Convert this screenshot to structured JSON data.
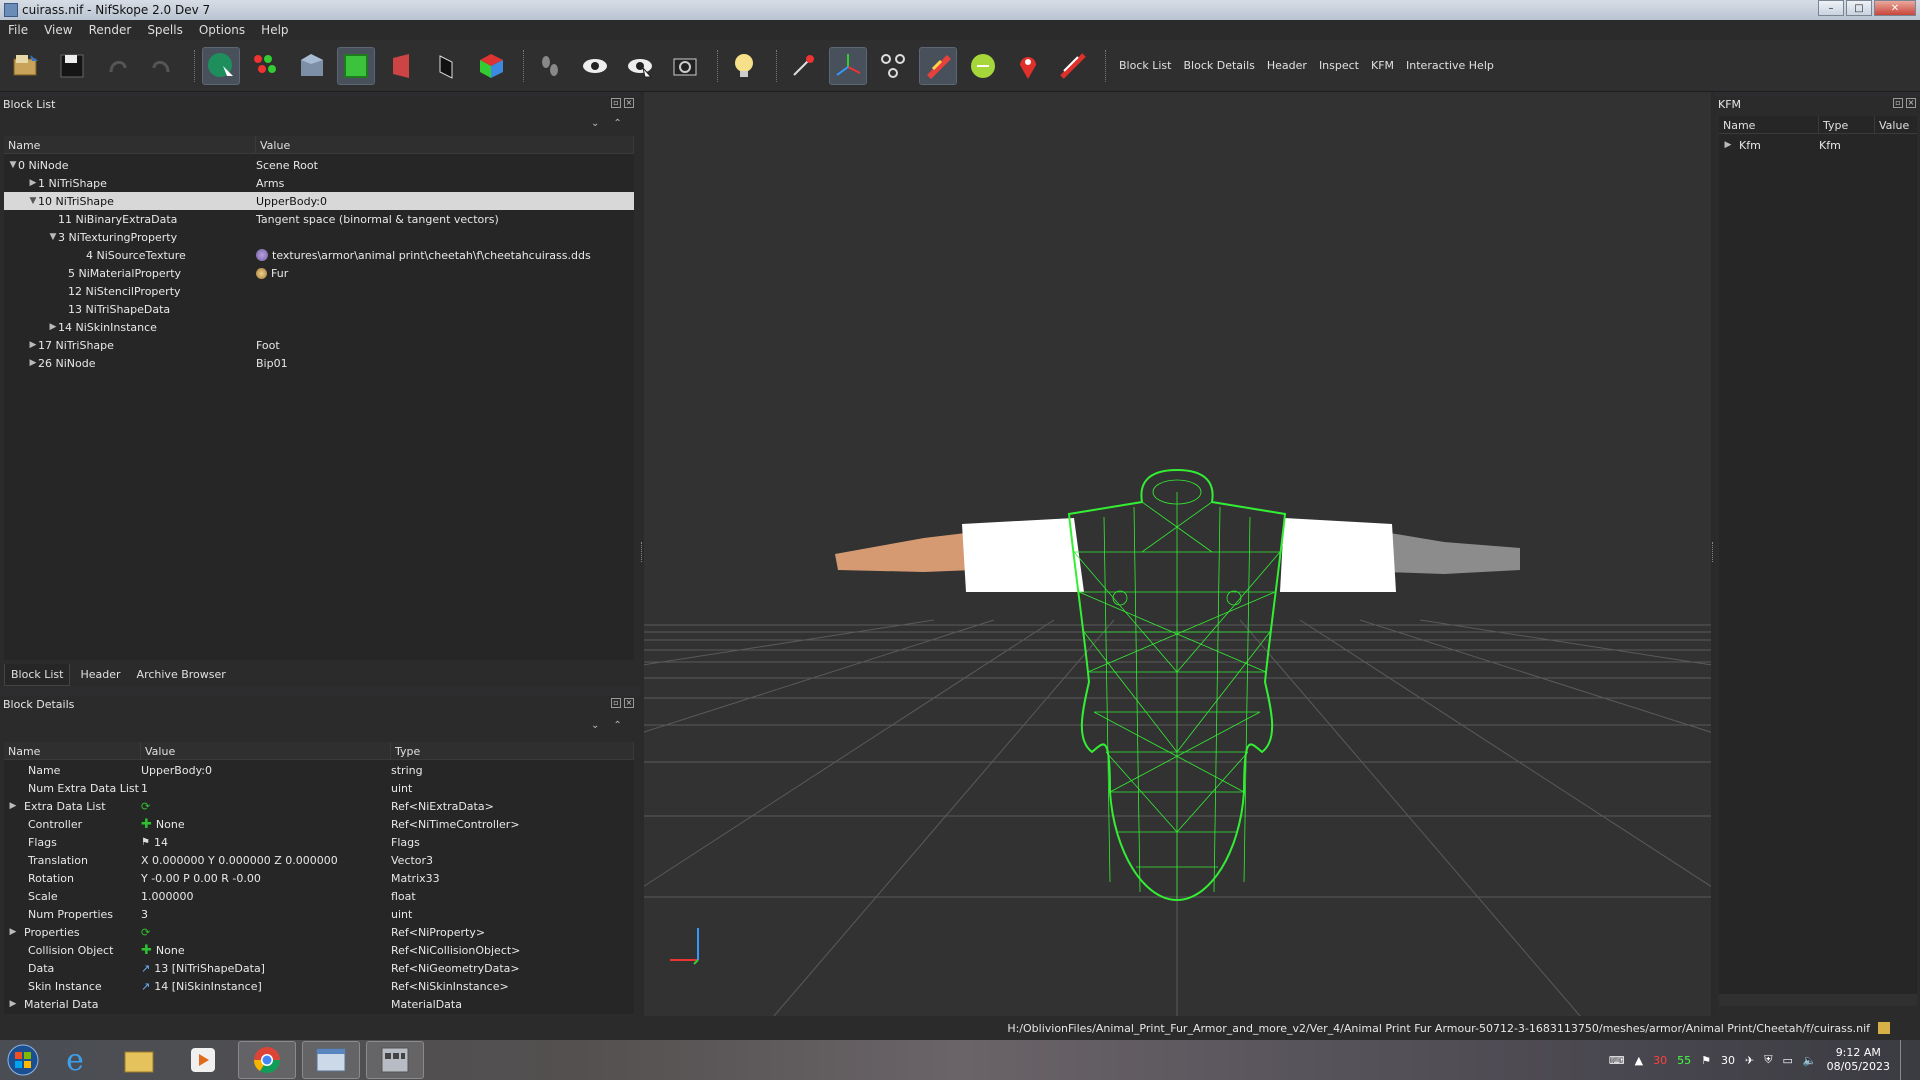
{
  "window": {
    "title": "cuirass.nif - NifSkope 2.0 Dev 7",
    "min": "–",
    "max": "□",
    "close": "✕"
  },
  "menu": [
    "File",
    "View",
    "Render",
    "Spells",
    "Options",
    "Help"
  ],
  "toolbar": {
    "text_buttons": [
      "Block List",
      "Block Details",
      "Header",
      "Inspect",
      "KFM",
      "Interactive Help"
    ]
  },
  "block_list": {
    "title": "Block List",
    "columns": [
      "Name",
      "Value"
    ],
    "rows": [
      {
        "name": "0 NiNode",
        "value": "Scene Root",
        "arrow": "▼"
      },
      {
        "name": "1 NiTriShape",
        "value": "Arms",
        "arrow": "▶"
      },
      {
        "name": "10 NiTriShape",
        "value": "UpperBody:0",
        "arrow": "▼"
      },
      {
        "name": "11 NiBinaryExtraData",
        "value": "Tangent space (binormal & tangent vectors)",
        "arrow": ""
      },
      {
        "name": "3 NiTexturingProperty",
        "value": "",
        "arrow": "▼"
      },
      {
        "name": "4 NiSourceTexture",
        "value": "textures\\armor\\animal print\\cheetah\\f\\cheetahcuirass.dds",
        "arrow": ""
      },
      {
        "name": "5 NiMaterialProperty",
        "value": "Fur",
        "arrow": ""
      },
      {
        "name": "12 NiStencilProperty",
        "value": "",
        "arrow": ""
      },
      {
        "name": "13 NiTriShapeData",
        "value": "",
        "arrow": ""
      },
      {
        "name": "14 NiSkinInstance",
        "value": "",
        "arrow": "▶"
      },
      {
        "name": "17 NiTriShape",
        "value": "Foot",
        "arrow": "▶"
      },
      {
        "name": "26 NiNode",
        "value": "Bip01",
        "arrow": "▶"
      }
    ]
  },
  "bottom_tabs": [
    "Block List",
    "Header",
    "Archive Browser"
  ],
  "block_details": {
    "title": "Block Details",
    "columns": [
      "Name",
      "Value",
      "Type"
    ],
    "rows": [
      {
        "name": "Name",
        "value": "UpperBody:0",
        "type": "string",
        "arrow": ""
      },
      {
        "name": "Num Extra Data List",
        "value": "1",
        "type": "uint",
        "arrow": ""
      },
      {
        "name": "Extra Data List",
        "value": "",
        "type": "Ref<NiExtraData>",
        "arrow": "▶"
      },
      {
        "name": "Controller",
        "value": "None",
        "type": "Ref<NiTimeController>",
        "arrow": ""
      },
      {
        "name": "Flags",
        "value": "14",
        "type": "Flags",
        "arrow": ""
      },
      {
        "name": "Translation",
        "value": "X 0.000000 Y 0.000000 Z 0.000000",
        "type": "Vector3",
        "arrow": ""
      },
      {
        "name": "Rotation",
        "value": "Y -0.00 P 0.00 R -0.00",
        "type": "Matrix33",
        "arrow": ""
      },
      {
        "name": "Scale",
        "value": "1.000000",
        "type": "float",
        "arrow": ""
      },
      {
        "name": "Num Properties",
        "value": "3",
        "type": "uint",
        "arrow": ""
      },
      {
        "name": "Properties",
        "value": "",
        "type": "Ref<NiProperty>",
        "arrow": "▶"
      },
      {
        "name": "Collision Object",
        "value": "None",
        "type": "Ref<NiCollisionObject>",
        "arrow": ""
      },
      {
        "name": "Data",
        "value": "13 [NiTriShapeData]",
        "type": "Ref<NiGeometryData>",
        "arrow": ""
      },
      {
        "name": "Skin Instance",
        "value": "14 [NiSkinInstance]",
        "type": "Ref<NiSkinInstance>",
        "arrow": ""
      },
      {
        "name": "Material Data",
        "value": "",
        "type": "MaterialData",
        "arrow": "▶"
      }
    ]
  },
  "kfm": {
    "title": "KFM",
    "columns": [
      "Name",
      "Type",
      "Value"
    ],
    "rows": [
      {
        "name": "Kfm",
        "type": "Kfm",
        "value": ""
      }
    ]
  },
  "status": {
    "path": "H:/OblivionFiles/Animal_Print_Fur_Armor_and_more_v2/Ver_4/Animal Print Fur Armour-50712-3-1683113750/meshes/armor/Animal Print/Cheetah/f/cuirass.nif"
  },
  "tray": {
    "num1": "30",
    "num2": "55",
    "num3": "30",
    "time": "9:12 AM",
    "date": "08/05/2023"
  },
  "colors": {
    "wire": "#33ee33",
    "sleeve": "#ffffff",
    "skin": "#d69a72",
    "grey_arm": "#8c8c8c"
  }
}
